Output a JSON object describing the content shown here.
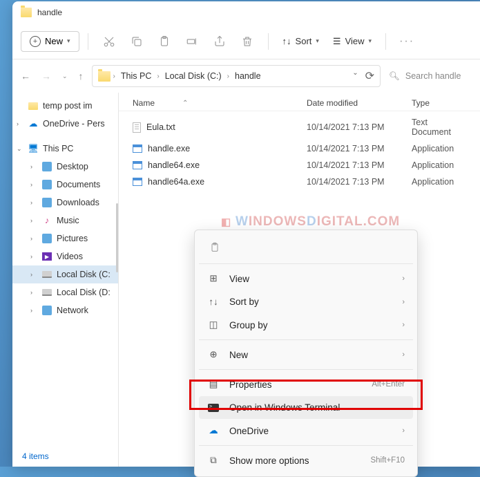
{
  "title": "handle",
  "toolbar": {
    "new": "New",
    "sort": "Sort",
    "view": "View"
  },
  "breadcrumbs": [
    "This PC",
    "Local Disk (C:)",
    "handle"
  ],
  "search_placeholder": "Search handle",
  "columns": {
    "name": "Name",
    "date": "Date modified",
    "type": "Type"
  },
  "sidebar": {
    "items": [
      {
        "label": "temp post im",
        "icon": "folder"
      },
      {
        "label": "OneDrive - Pers",
        "icon": "cloud"
      },
      {
        "label": "This PC",
        "icon": "pc",
        "expanded": true
      },
      {
        "label": "Desktop",
        "icon": "generic",
        "indent": true
      },
      {
        "label": "Documents",
        "icon": "generic",
        "indent": true
      },
      {
        "label": "Downloads",
        "icon": "generic",
        "indent": true
      },
      {
        "label": "Music",
        "icon": "music",
        "indent": true
      },
      {
        "label": "Pictures",
        "icon": "generic",
        "indent": true
      },
      {
        "label": "Videos",
        "icon": "video",
        "indent": true
      },
      {
        "label": "Local Disk (C:",
        "icon": "disk",
        "indent": true,
        "selected": true
      },
      {
        "label": "Local Disk (D:",
        "icon": "disk",
        "indent": true
      },
      {
        "label": "Network",
        "icon": "generic",
        "indent": true
      }
    ]
  },
  "files": [
    {
      "name": "Eula.txt",
      "date": "10/14/2021 7:13 PM",
      "type": "Text Document",
      "icon": "txt"
    },
    {
      "name": "handle.exe",
      "date": "10/14/2021 7:13 PM",
      "type": "Application",
      "icon": "exe"
    },
    {
      "name": "handle64.exe",
      "date": "10/14/2021 7:13 PM",
      "type": "Application",
      "icon": "exe"
    },
    {
      "name": "handle64a.exe",
      "date": "10/14/2021 7:13 PM",
      "type": "Application",
      "icon": "exe"
    }
  ],
  "status": "4 items",
  "watermark": {
    "w1": "W",
    "w2": "INDOWS",
    "d": "D",
    "rest": "IGITAL.COM"
  },
  "context": {
    "view": "View",
    "sortby": "Sort by",
    "groupby": "Group by",
    "new": "New",
    "properties": "Properties",
    "properties_key": "Alt+Enter",
    "terminal": "Open in Windows Terminal",
    "onedrive": "OneDrive",
    "more": "Show more options",
    "more_key": "Shift+F10"
  }
}
